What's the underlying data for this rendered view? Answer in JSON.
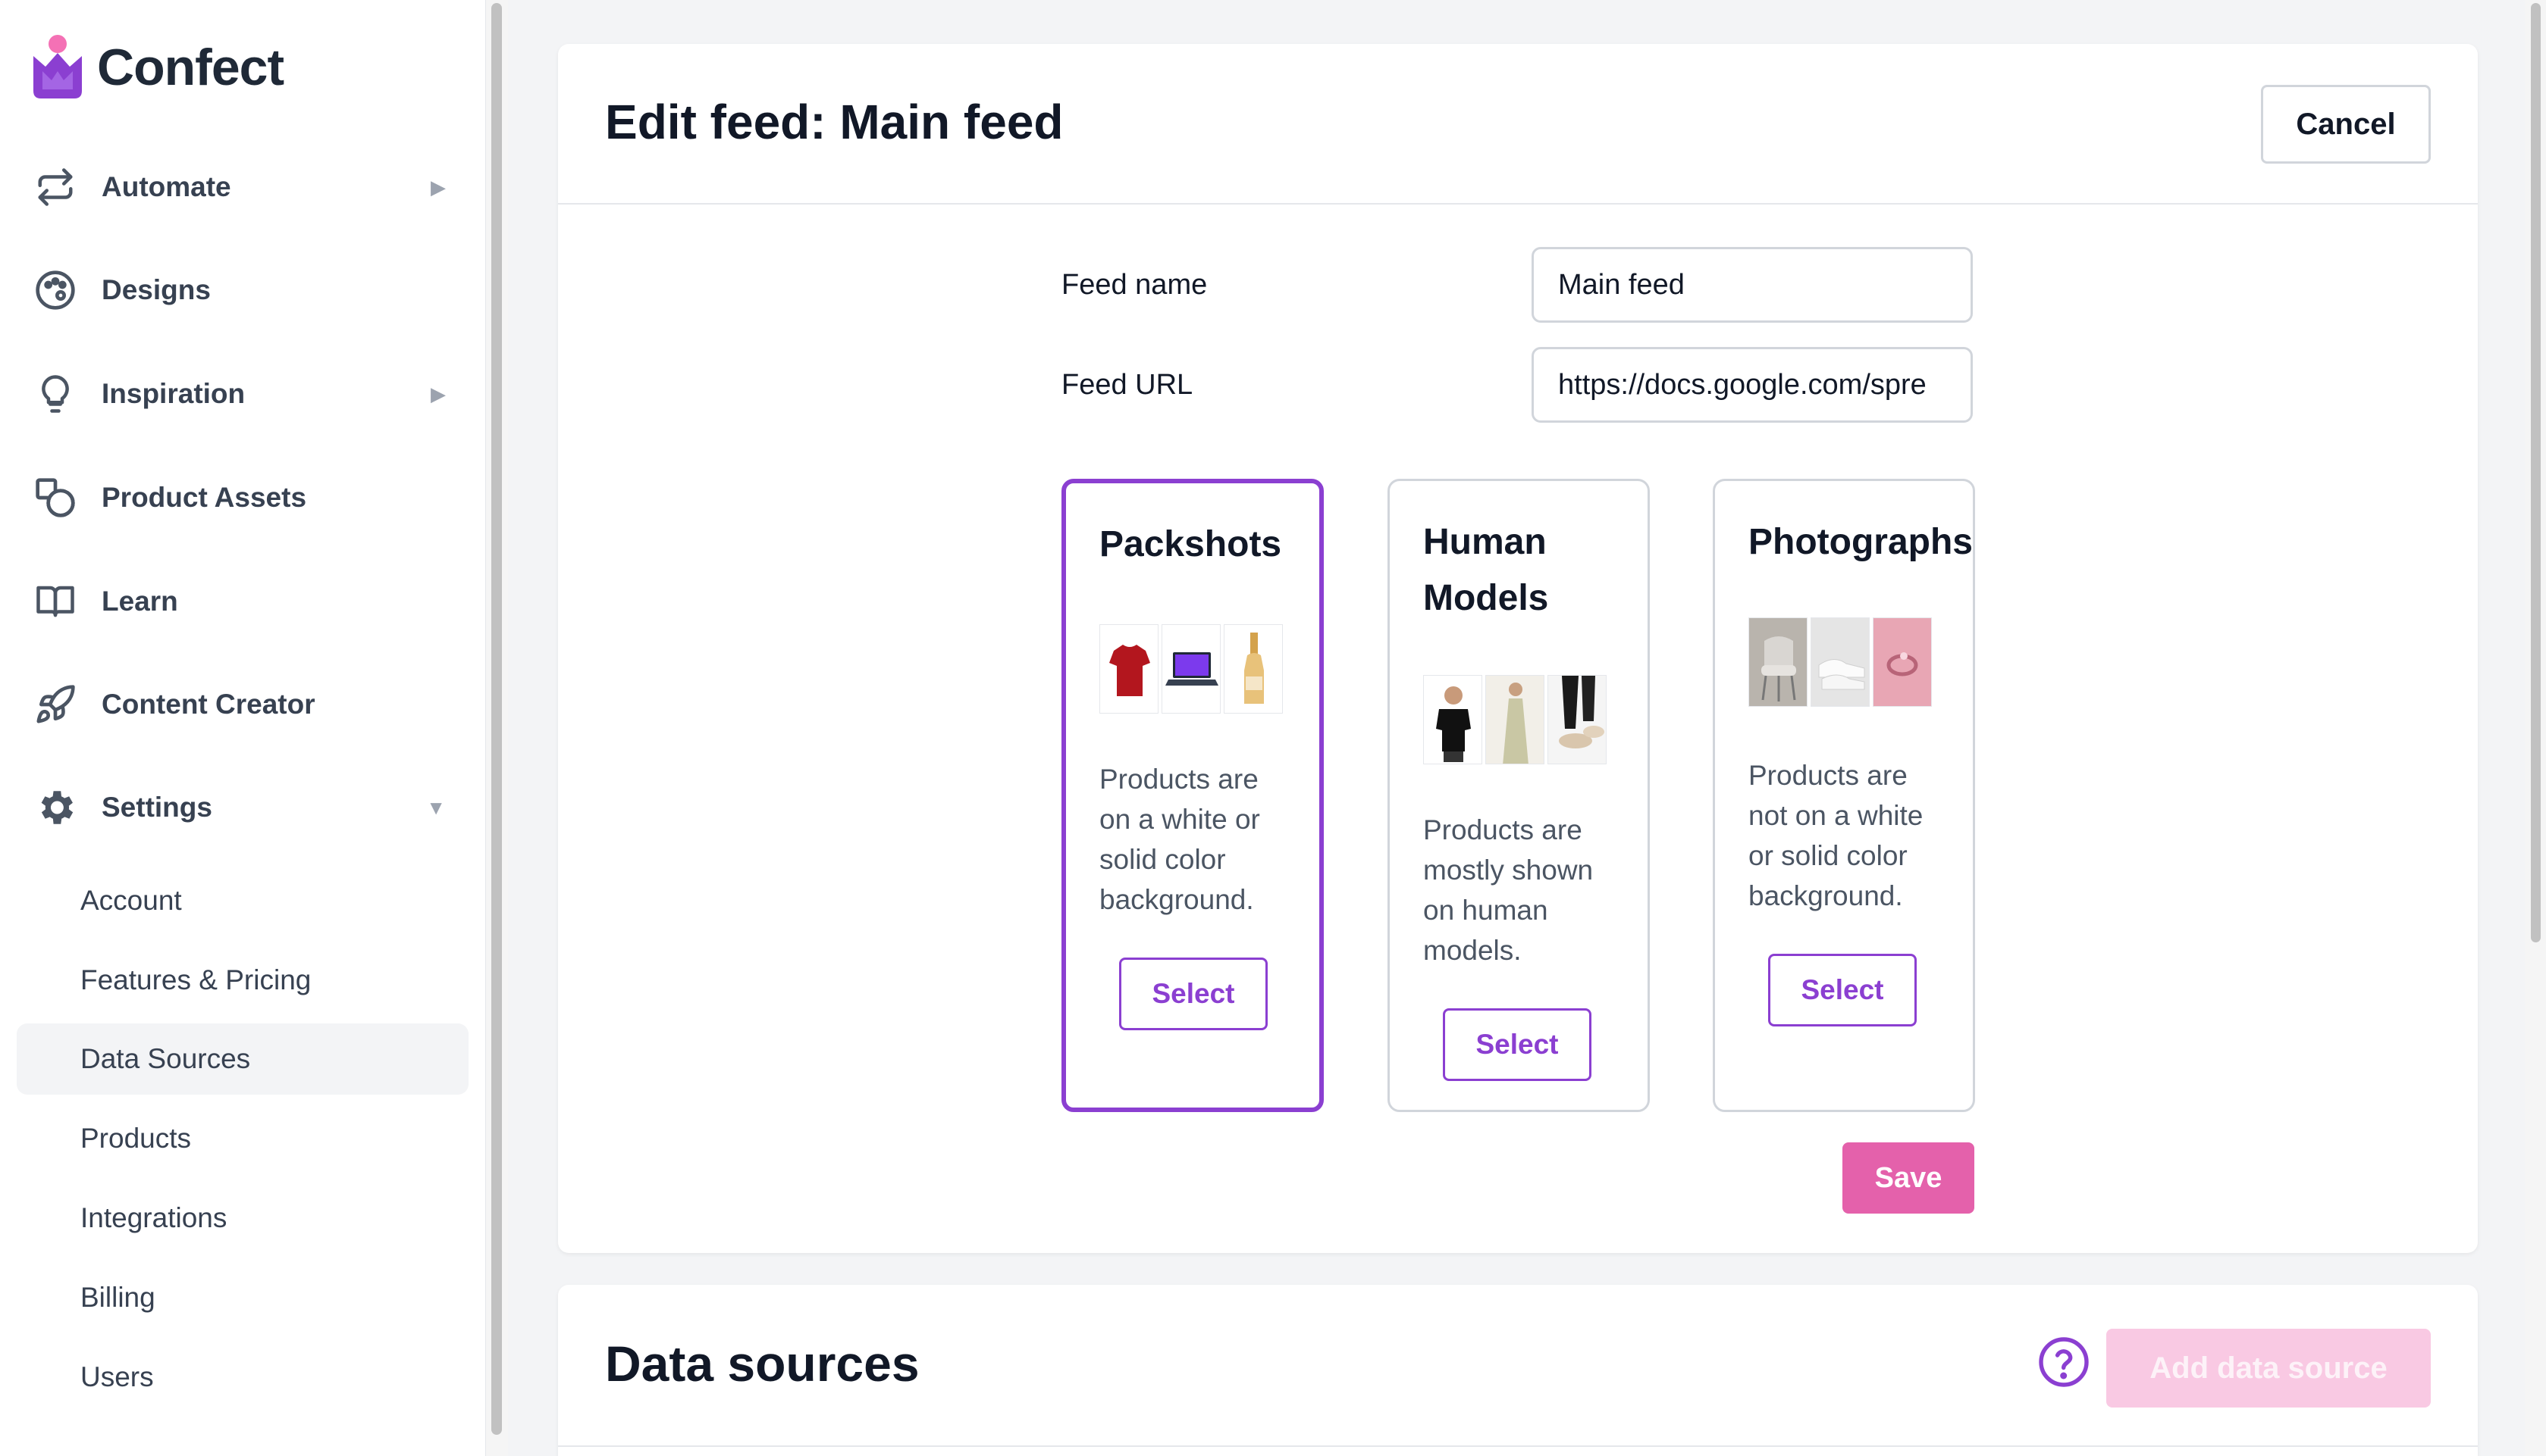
{
  "app": {
    "name": "Confect"
  },
  "sidebar": {
    "nav": [
      {
        "label": "Automate",
        "icon": "repeat-icon",
        "caret": "▶"
      },
      {
        "label": "Designs",
        "icon": "palette-icon",
        "caret": ""
      },
      {
        "label": "Inspiration",
        "icon": "lightbulb-icon",
        "caret": "▶"
      },
      {
        "label": "Product Assets",
        "icon": "shapes-icon",
        "caret": ""
      },
      {
        "label": "Learn",
        "icon": "book-icon",
        "caret": ""
      },
      {
        "label": "Content Creator",
        "icon": "rocket-icon",
        "caret": ""
      },
      {
        "label": "Settings",
        "icon": "gear-icon",
        "caret": "▼"
      }
    ],
    "settings_items": [
      "Account",
      "Features & Pricing",
      "Data Sources",
      "Products",
      "Integrations",
      "Billing",
      "Users"
    ],
    "active_item": "Data Sources"
  },
  "edit_feed": {
    "title": "Edit feed: Main feed",
    "cancel_label": "Cancel",
    "feed_name_label": "Feed name",
    "feed_name_value": "Main feed",
    "feed_url_label": "Feed URL",
    "feed_url_value": "https://docs.google.com/spre",
    "cards": [
      {
        "title_lines": [
          "Packshots"
        ],
        "desc_lines": [
          "Products are",
          "on a white or",
          "solid color",
          "background."
        ],
        "select_label": "Select",
        "selected": true
      },
      {
        "title_lines": [
          "Human",
          "Models"
        ],
        "desc_lines": [
          "Products are",
          "mostly shown",
          "on human",
          "models."
        ],
        "select_label": "Select",
        "selected": false
      },
      {
        "title_lines": [
          "Photographs"
        ],
        "desc_lines": [
          "Products are",
          "not on a white",
          "or solid color",
          "background."
        ],
        "select_label": "Select",
        "selected": false
      }
    ],
    "save_label": "Save"
  },
  "data_sources": {
    "title": "Data sources",
    "add_label": "Add data source"
  },
  "colors": {
    "accent_purple": "#8b3fd1",
    "save_pink": "#e461ab",
    "add_disabled_pink": "#f9c9e3"
  }
}
